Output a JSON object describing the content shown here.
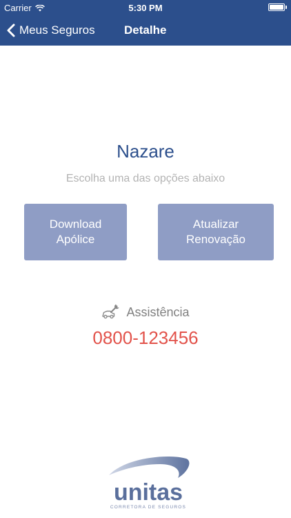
{
  "status_bar": {
    "carrier": "Carrier",
    "time": "5:30 PM"
  },
  "nav": {
    "back_label": "Meus Seguros",
    "title": "Detalhe"
  },
  "content": {
    "title": "Nazare",
    "subtitle": "Escolha uma das opções abaixo",
    "buttons": [
      {
        "label": "Download\nApólice"
      },
      {
        "label": "Atualizar\nRenovação"
      }
    ],
    "assist_label": "Assistência",
    "assist_icon": "car-wrench-icon",
    "phone": "0800-123456"
  },
  "logo": {
    "name": "unitas",
    "tagline": "CORRETORA DE SEGUROS"
  },
  "colors": {
    "brand": "#2c4f8c",
    "button": "#8f9dc5",
    "phone": "#e2524a",
    "muted": "#b3b3b3"
  }
}
